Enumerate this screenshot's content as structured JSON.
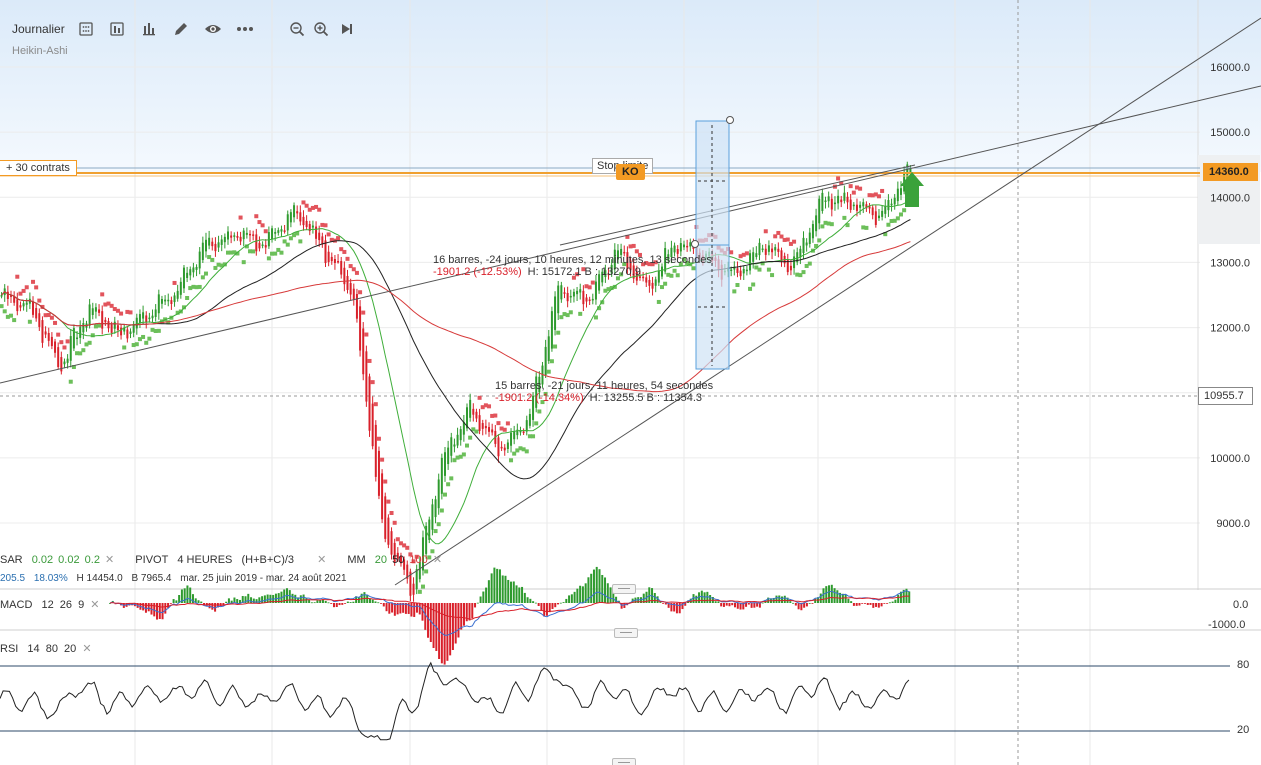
{
  "toolbar": {
    "timeframe": "Journalier",
    "chart_type": "Heikin-Ashi",
    "icons": [
      "calculator-icon",
      "panel-icon",
      "bar-chart-icon",
      "pencil-icon",
      "eye-icon",
      "more-icon",
      "zoom-out-icon",
      "zoom-in-icon",
      "play-end-icon"
    ]
  },
  "price_axis": {
    "ticks": [
      "16000.0",
      "15000.0",
      "14000.0",
      "13000.0",
      "12000.0",
      "10000.0",
      "9000.0"
    ],
    "current_price": "14360.0",
    "crosshair_price": "10955.7"
  },
  "position": {
    "label": "+ 30 contrats",
    "stop_label": "Stop limite",
    "ko_label": "KO"
  },
  "measure_1": {
    "line1": "16 barres, -24 jours, 10 heures, 12 minutes, 13 secondes",
    "change": "-1901.2 (-12.53%)",
    "hb": "H: 15172.1 B : 13270.9"
  },
  "measure_2": {
    "line1": "15 barres, -21 jours, 11 heures, 54 secondes",
    "change": "-1901.2 (-14.34%)",
    "hb": "H: 13255.5 B : 11354.3"
  },
  "indicators": {
    "sar_name": "SAR",
    "sar_params": [
      "0.02",
      "0.02",
      "0.2"
    ],
    "pivot_name": "PIVOT",
    "pivot_params": "4 HEURES",
    "pivot_formula": "(H+B+C)/3",
    "mm_name": "MM",
    "mm_params": [
      "20",
      "50",
      "100"
    ],
    "range_value": "205.5",
    "range_pct": "18.03%",
    "range_high": "H 14454.0",
    "range_low": "B 7965.4",
    "range_dates": "mar. 25 juin 2019 - mar. 24 août 2021"
  },
  "macd": {
    "name": "MACD",
    "params": [
      "12",
      "26",
      "9"
    ],
    "ticks": [
      "0.0",
      "-1000.0"
    ]
  },
  "rsi": {
    "name": "RSI",
    "params": [
      "14",
      "80",
      "20"
    ],
    "ticks": [
      "80",
      "20"
    ]
  },
  "colors": {
    "bull": "#2e9a2e",
    "bear": "#d9202a",
    "sar_bull": "#6cbf5a",
    "sar_bear": "#e2545c",
    "mm20": "#3fae3a",
    "mm50": "#222222",
    "mm100": "#d73a3a",
    "position_line": "#f0a030",
    "measure_box": "#5aa0dc"
  },
  "chart_data": {
    "type": "line",
    "title": "",
    "ylim": [
      7965.4,
      16400
    ],
    "price_path": [
      12500,
      12300,
      11400,
      12300,
      11900,
      12200,
      12600,
      13300,
      13400,
      13300,
      13800,
      13200,
      12500,
      8900,
      7965,
      9900,
      10800,
      10100,
      10600,
      12600,
      12400,
      13200,
      12600,
      13300,
      13100,
      12800,
      13300,
      12900,
      14000,
      13900,
      13700,
      14454
    ],
    "rsi_ylim": [
      0,
      100
    ],
    "rsi_levels": [
      80,
      20
    ]
  }
}
